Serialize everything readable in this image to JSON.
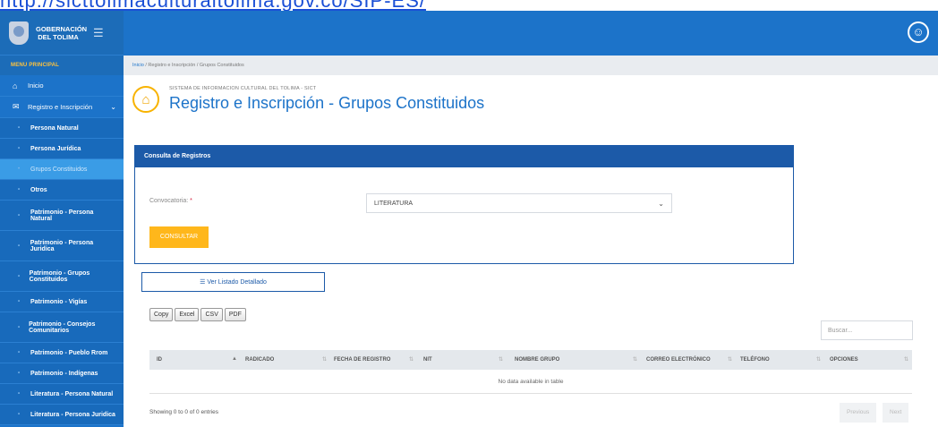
{
  "url": "http://sicttolimaculturaltolima.gov.co/SIP-ES/",
  "brand": {
    "line1": "GOBERNACIÓN",
    "line2": "DEL TOLIMA"
  },
  "menu_title": "MENU PRINCIPAL",
  "nav": [
    {
      "label": "Inicio",
      "icon": "home-icon",
      "type": "top"
    },
    {
      "label": "Registro e Inscripción",
      "icon": "register-icon",
      "type": "top-open"
    },
    {
      "label": "Persona Natural",
      "type": "sub"
    },
    {
      "label": "Persona Jurídica",
      "type": "sub"
    },
    {
      "label": "Grupos Constituidos",
      "type": "sub-active"
    },
    {
      "label": "Otros",
      "type": "sub"
    },
    {
      "label": "Patrimonio - Persona Natural",
      "type": "sub2"
    },
    {
      "label": "Patrimonio - Persona Juridica",
      "type": "sub2"
    },
    {
      "label": "Patrimonio - Grupos Constituidos",
      "type": "sub2"
    },
    {
      "label": "Patrimonio - Vigías",
      "type": "sub"
    },
    {
      "label": "Patrimonio - Consejos Comunitarios",
      "type": "sub2"
    },
    {
      "label": "Patrimonio - Pueblo Rrom",
      "type": "sub"
    },
    {
      "label": "Patrimonio - Indígenas",
      "type": "sub"
    },
    {
      "label": "Literatura - Persona Natural",
      "type": "sub"
    },
    {
      "label": "Literatura - Persona Juridica",
      "type": "sub"
    }
  ],
  "breadcrumb": {
    "home": "Inicio",
    "rest": " /  Registro e Inscripción / Grupos Constituidos"
  },
  "page": {
    "subtitle": "SISTEMA DE INFORMACION CULTURAL DEL TOLIMA - SICT",
    "title": "Registro e Inscripción - Grupos Constituidos"
  },
  "form": {
    "header": "Consulta de Registros",
    "label": "Convocatoria:",
    "required": "*",
    "selected": "LITERATURA",
    "button": "CONSULTAR"
  },
  "list_button": "Ver Listado Detallado",
  "export": [
    "Copy",
    "Excel",
    "CSV",
    "PDF"
  ],
  "search_placeholder": "Buscar...",
  "table": {
    "columns": [
      "ID",
      "RADICADO",
      "FECHA DE REGISTRO",
      "NIT",
      "NOMBRE GRUPO",
      "CORREO ELECTRÓNICO",
      "TELÉFONO",
      "OPCIONES"
    ],
    "empty": "No data available in table"
  },
  "info": "Showing 0 to 0 of 0 entries",
  "pagination": {
    "prev": "Previous",
    "next": "Next"
  }
}
